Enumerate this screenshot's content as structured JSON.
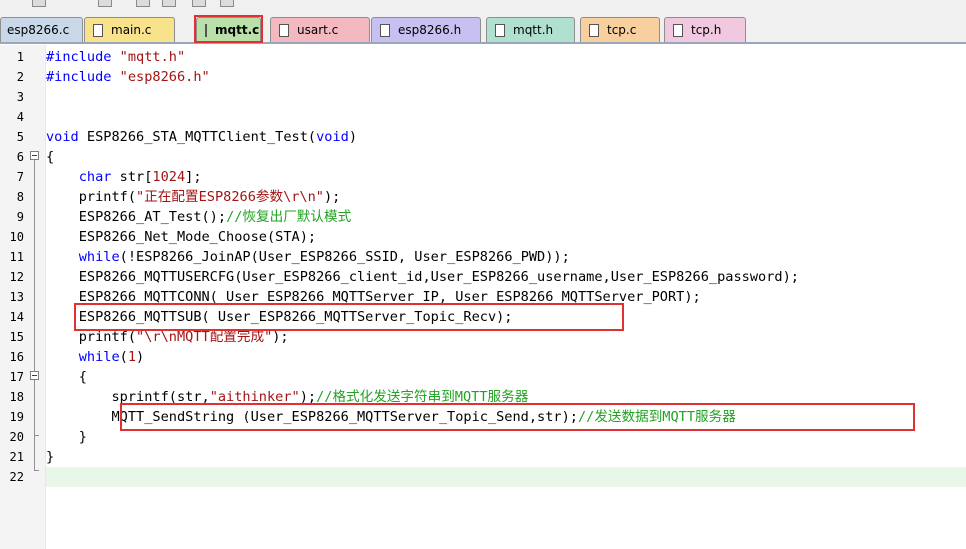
{
  "tabs": [
    {
      "label": "esp8266.c",
      "color": "#c8d8e8",
      "has_icon": false
    },
    {
      "label": "main.c",
      "color": "#f8e28c",
      "has_icon": true
    },
    {
      "label": "mqtt.c",
      "color": "#b8e0a8",
      "has_icon": true,
      "active": true
    },
    {
      "label": "usart.c",
      "color": "#f4b8c0",
      "has_icon": true
    },
    {
      "label": "esp8266.h",
      "color": "#c8c0f0",
      "has_icon": true
    },
    {
      "label": "mqtt.h",
      "color": "#b0e0d0",
      "has_icon": true
    },
    {
      "label": "tcp.c",
      "color": "#f8d0a0",
      "has_icon": true
    },
    {
      "label": "tcp.h",
      "color": "#f0c8e0",
      "has_icon": true
    }
  ],
  "lines": [
    {
      "n": "1",
      "tokens": [
        [
          "pp",
          "#include "
        ],
        [
          "str",
          "\"mqtt.h\""
        ]
      ]
    },
    {
      "n": "2",
      "tokens": [
        [
          "pp",
          "#include "
        ],
        [
          "str",
          "\"esp8266.h\""
        ]
      ]
    },
    {
      "n": "3",
      "tokens": []
    },
    {
      "n": "4",
      "tokens": []
    },
    {
      "n": "5",
      "tokens": [
        [
          "kw",
          "void"
        ],
        [
          "",
          " ESP8266_STA_MQTTClient_Test("
        ],
        [
          "kw",
          "void"
        ],
        [
          "",
          ")"
        ]
      ]
    },
    {
      "n": "6",
      "tokens": [
        [
          "",
          "{"
        ]
      ]
    },
    {
      "n": "7",
      "tokens": [
        [
          "",
          "    "
        ],
        [
          "kw",
          "char"
        ],
        [
          "",
          " str["
        ],
        [
          "num",
          "1024"
        ],
        [
          "",
          "];"
        ]
      ]
    },
    {
      "n": "8",
      "tokens": [
        [
          "",
          "    printf("
        ],
        [
          "str",
          "\"正在配置ESP8266参数\\r\\n\""
        ],
        [
          "",
          ");"
        ]
      ]
    },
    {
      "n": "9",
      "tokens": [
        [
          "",
          "    ESP8266_AT_Test();"
        ],
        [
          "cmt",
          "//恢复出厂默认模式"
        ]
      ]
    },
    {
      "n": "10",
      "tokens": [
        [
          "",
          "    ESP8266_Net_Mode_Choose(STA);"
        ]
      ]
    },
    {
      "n": "11",
      "tokens": [
        [
          "",
          "    "
        ],
        [
          "kw",
          "while"
        ],
        [
          "",
          "(!ESP8266_JoinAP(User_ESP8266_SSID, User_ESP8266_PWD));"
        ]
      ]
    },
    {
      "n": "12",
      "tokens": [
        [
          "",
          "    ESP8266_MQTTUSERCFG(User_ESP8266_client_id,User_ESP8266_username,User_ESP8266_password);"
        ]
      ]
    },
    {
      "n": "13",
      "tokens": [
        [
          "",
          "    ESP8266_MQTTCONN( User_ESP8266_MQTTServer_IP, User_ESP8266_MQTTServer_PORT);"
        ]
      ]
    },
    {
      "n": "14",
      "tokens": [
        [
          "",
          "    ESP8266_MQTTSUB( User_ESP8266_MQTTServer_Topic_Recv);"
        ]
      ]
    },
    {
      "n": "15",
      "tokens": [
        [
          "",
          "    printf("
        ],
        [
          "str",
          "\"\\r\\nMQTT配置完成\""
        ],
        [
          "",
          ");"
        ]
      ]
    },
    {
      "n": "16",
      "tokens": [
        [
          "",
          "    "
        ],
        [
          "kw",
          "while"
        ],
        [
          "",
          "("
        ],
        [
          "num",
          "1"
        ],
        [
          "",
          ")"
        ]
      ]
    },
    {
      "n": "17",
      "tokens": [
        [
          "",
          "    {"
        ]
      ]
    },
    {
      "n": "18",
      "tokens": [
        [
          "",
          "        sprintf(str,"
        ],
        [
          "str",
          "\"aithinker\""
        ],
        [
          "",
          ");"
        ],
        [
          "cmt",
          "//格式化发送字符串到MQTT服务器"
        ]
      ]
    },
    {
      "n": "19",
      "tokens": [
        [
          "",
          "        MQTT_SendString (User_ESP8266_MQTTServer_Topic_Send,str);"
        ],
        [
          "cmt",
          "//发送数据到MQTT服务器"
        ]
      ]
    },
    {
      "n": "20",
      "tokens": [
        [
          "",
          "    }"
        ]
      ]
    },
    {
      "n": "21",
      "tokens": [
        [
          "",
          "}"
        ]
      ]
    },
    {
      "n": "22",
      "tokens": []
    }
  ],
  "current_line": "22"
}
